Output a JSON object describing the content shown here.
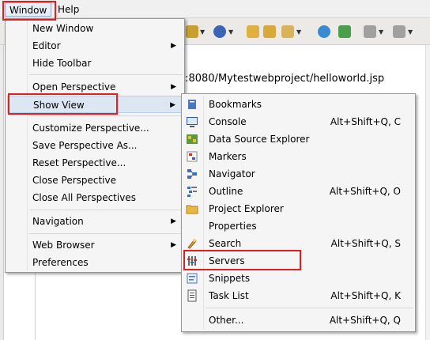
{
  "menubar": {
    "window": "Window",
    "help": "Help"
  },
  "editor": {
    "address": "t:8080/Mytestwebproject/helloworld.jsp"
  },
  "window_menu": {
    "new_window": "New Window",
    "editor": "Editor",
    "hide_toolbar": "Hide Toolbar",
    "open_perspective": "Open Perspective",
    "show_view": "Show View",
    "customize_perspective": "Customize Perspective...",
    "save_perspective": "Save Perspective As...",
    "reset_perspective": "Reset Perspective...",
    "close_perspective": "Close Perspective",
    "close_all_perspectives": "Close All Perspectives",
    "navigation": "Navigation",
    "web_browser": "Web Browser",
    "preferences": "Preferences"
  },
  "show_view_menu": {
    "bookmarks": "Bookmarks",
    "console": "Console",
    "console_accel": "Alt+Shift+Q, C",
    "data_source_explorer": "Data Source Explorer",
    "markers": "Markers",
    "navigator": "Navigator",
    "outline": "Outline",
    "outline_accel": "Alt+Shift+Q, O",
    "project_explorer": "Project Explorer",
    "properties": "Properties",
    "search": "Search",
    "search_accel": "Alt+Shift+Q, S",
    "servers": "Servers",
    "snippets": "Snippets",
    "task_list": "Task List",
    "task_list_accel": "Alt+Shift+Q, K",
    "other": "Other...",
    "other_accel": "Alt+Shift+Q, Q"
  },
  "icons": {
    "bookmarks": "bookmark-icon",
    "console": "console-icon",
    "data_source_explorer": "data-source-icon",
    "markers": "markers-icon",
    "navigator": "navigator-icon",
    "outline": "outline-icon",
    "project_explorer": "folder-icon",
    "search": "search-icon",
    "servers": "servers-icon",
    "snippets": "snippets-icon",
    "task_list": "task-list-icon"
  },
  "colors": {
    "highlight": "#dde6f3",
    "callout": "#e02020",
    "menu_bg": "#f5f5f5"
  }
}
